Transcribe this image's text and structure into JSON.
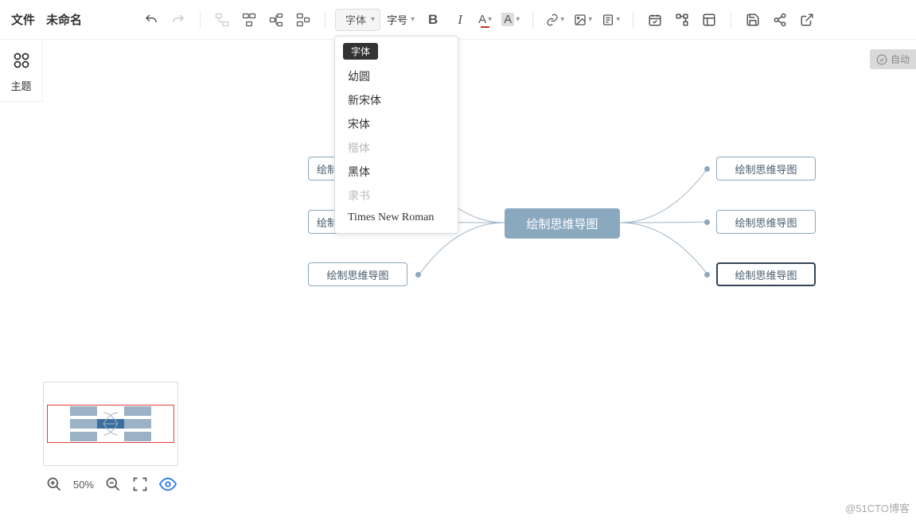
{
  "header": {
    "file_label": "文件",
    "file_name": "未命名"
  },
  "toolbar": {
    "font_label": "字体",
    "size_label": "字号"
  },
  "left_panel": {
    "theme_label": "主题"
  },
  "autosave": {
    "label": "自动"
  },
  "font_popup": {
    "chip": "字体",
    "options": [
      {
        "label": "幼圆",
        "muted": false
      },
      {
        "label": "新宋体",
        "muted": false
      },
      {
        "label": "宋体",
        "muted": false
      },
      {
        "label": "楷体",
        "muted": true
      },
      {
        "label": "黑体",
        "muted": false
      },
      {
        "label": "隶书",
        "muted": true
      },
      {
        "label": "Times New Roman",
        "muted": false
      }
    ]
  },
  "mindmap": {
    "center": "绘制思维导图",
    "left_nodes": [
      "绘制思维导",
      "绘制思维导",
      "绘制思维导图"
    ],
    "right_nodes": [
      "绘制思维导图",
      "绘制思维导图",
      "绘制思维导图"
    ]
  },
  "zoom": {
    "level": "50%"
  },
  "watermark": "@51CTO博客"
}
